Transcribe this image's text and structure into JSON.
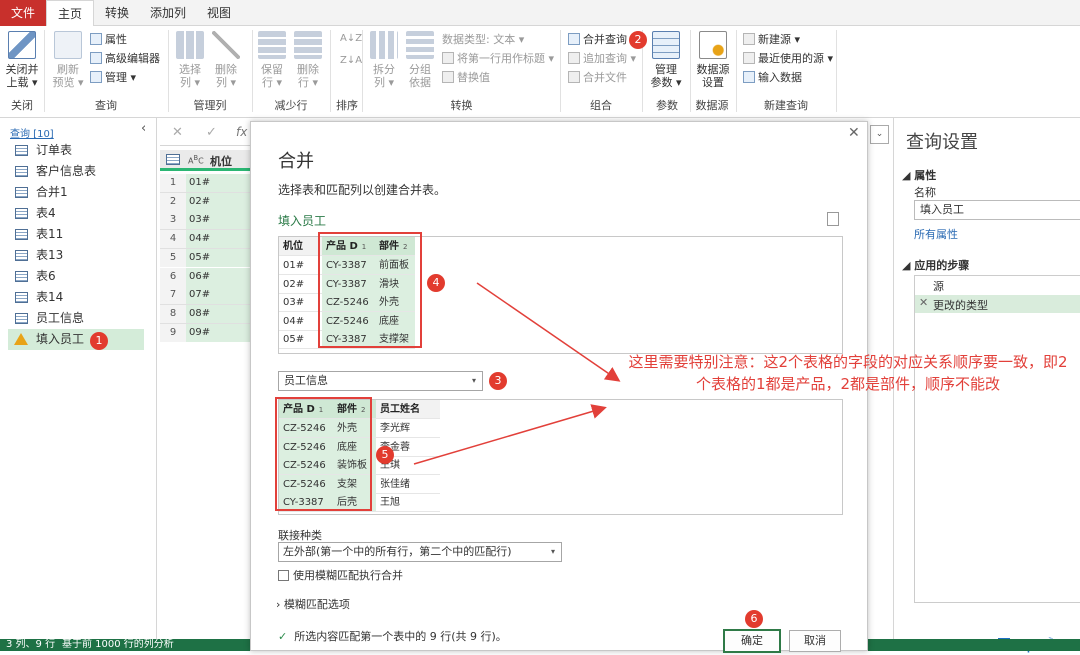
{
  "tabs": [
    "文件",
    "主页",
    "转换",
    "添加列",
    "视图"
  ],
  "ribbon": {
    "close_load": [
      "关闭并",
      "上载 ▾"
    ],
    "refresh": [
      "刷新",
      "预览 ▾"
    ],
    "properties": "属性",
    "advanced_editor": "高级编辑器",
    "manage": "管理 ▾",
    "choose_cols": [
      "选择",
      "列 ▾"
    ],
    "remove_cols": [
      "删除",
      "列 ▾"
    ],
    "keep_rows": [
      "保留",
      "行 ▾"
    ],
    "remove_rows": [
      "删除",
      "行 ▾"
    ],
    "split_col": [
      "拆分",
      "列 ▾"
    ],
    "group_by": [
      "分组",
      "依据"
    ],
    "data_type": "数据类型: 文本 ▾",
    "first_row_header": "将第一行用作标题 ▾",
    "replace_values": "替换值",
    "merge_queries": "合并查询",
    "append_queries": "追加查询 ▾",
    "combine_files": "合并文件",
    "manage_params": [
      "管理",
      "参数 ▾"
    ],
    "ds_settings": [
      "数据源",
      "设置"
    ],
    "new_source": "新建源 ▾",
    "recent_sources": "最近使用的源 ▾",
    "enter_data": "输入数据",
    "groups": [
      "关闭",
      "查询",
      "管理列",
      "减少行",
      "排序",
      "转换",
      "组合",
      "参数",
      "数据源",
      "新建查询"
    ]
  },
  "left": {
    "header": "查询 [10]",
    "items": [
      "订单表",
      "客户信息表",
      "合并1",
      "表4",
      "表11",
      "表13",
      "表6",
      "表14",
      "员工信息",
      "填入员工"
    ]
  },
  "grid": {
    "header": "机位",
    "rows": [
      "1",
      "2",
      "3",
      "4",
      "5",
      "6",
      "7",
      "8",
      "9"
    ],
    "values": [
      "01#",
      "02#",
      "03#",
      "04#",
      "05#",
      "06#",
      "07#",
      "08#",
      "09#"
    ]
  },
  "formula": {
    "x": "✕",
    "check": "✓",
    "fx": "fx"
  },
  "right": {
    "title": "查询设置",
    "props": "属性",
    "name_label": "名称",
    "name_value": "填入员工",
    "all_props": "所有属性",
    "steps": "应用的步骤",
    "step1": "源",
    "step2": "更改的类型"
  },
  "status": {
    "left": "3 列、9 行",
    "mid": "基于前 1000 行的列分析"
  },
  "dialog": {
    "title": "合并",
    "desc": "选择表和匹配列以创建合并表。",
    "table1_name": "填入员工",
    "t1_headers": [
      "机位",
      "产品 D",
      "部件"
    ],
    "t1_rows": [
      [
        "01#",
        "CY-3387",
        "前面板"
      ],
      [
        "02#",
        "CY-3387",
        "滑块"
      ],
      [
        "03#",
        "CZ-5246",
        "外壳"
      ],
      [
        "04#",
        "CZ-5246",
        "底座"
      ],
      [
        "05#",
        "CY-3387",
        "支撑架"
      ]
    ],
    "table2_select": "员工信息",
    "t2_headers": [
      "产品 D",
      "部件",
      "员工姓名"
    ],
    "t2_rows": [
      [
        "CZ-5246",
        "外壳",
        "李光辉"
      ],
      [
        "CZ-5246",
        "底座",
        "李金蓉"
      ],
      [
        "CZ-5246",
        "装饰板",
        "王琪"
      ],
      [
        "CZ-5246",
        "支架",
        "张佳绪"
      ],
      [
        "CY-3387",
        "后壳",
        "王旭"
      ]
    ],
    "join_label": "联接种类",
    "join_value": "左外部(第一个中的所有行，第二个中的匹配行)",
    "fuzzy_check": "使用模糊匹配执行合并",
    "fuzzy_options": "模糊匹配选项",
    "match_info": "所选内容匹配第一个表中的 9 行(共 9 行)。",
    "ok": "确定",
    "cancel": "取消"
  },
  "annotation": "这里需要特别注意：这2个表格的字段的对应关系顺序要一致，即2个表格的1都是产品，2都是部件，顺序不能改",
  "badges": [
    "1",
    "2",
    "3",
    "4",
    "5",
    "6"
  ],
  "colors": {
    "accent": "#1e7145",
    "file_tab": "#c8302c",
    "red": "#e2403a",
    "green_fill": "#dcefe0"
  }
}
